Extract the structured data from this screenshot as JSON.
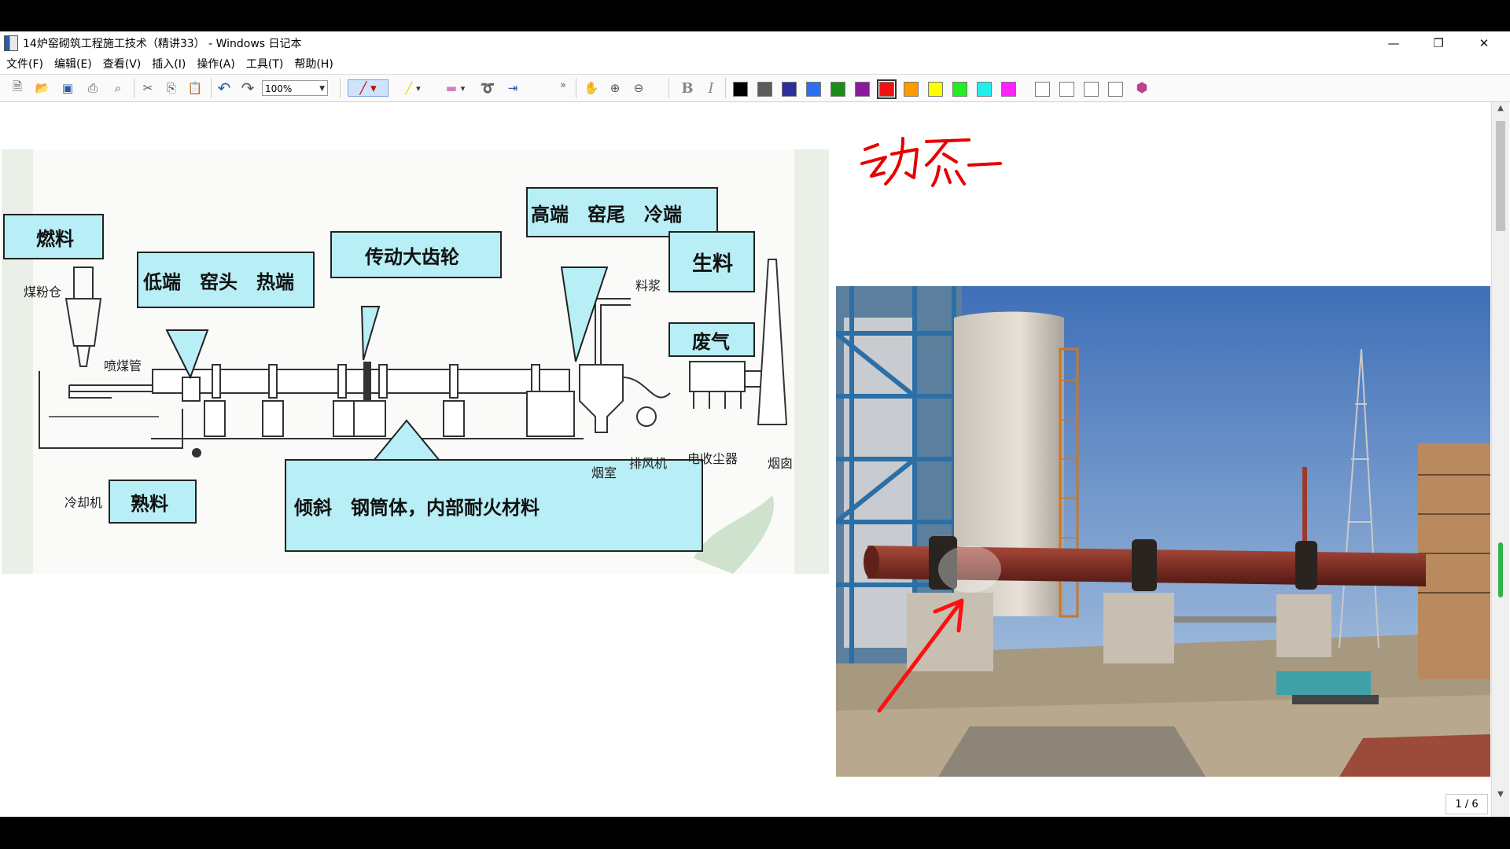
{
  "window": {
    "title": "14炉窑砌筑工程施工技术（精讲33） - Windows 日记本"
  },
  "menu": [
    "文件(F)",
    "编辑(E)",
    "查看(V)",
    "插入(I)",
    "操作(A)",
    "工具(T)",
    "帮助(H)"
  ],
  "toolbar": {
    "zoom_value": "100%",
    "colors": [
      "#000000",
      "#5c5c5c",
      "#2d2d9c",
      "#2e6ff2",
      "#1a8c1a",
      "#8c1a9c",
      "#ee1111",
      "#ff9900",
      "#ffff00",
      "#22ee22",
      "#22eeee",
      "#ff22ff",
      "#ffffff",
      "#ffffff",
      "#ffffff",
      "#ffffff"
    ],
    "selected_color": "#ee1111"
  },
  "diagram": {
    "labels": {
      "fuel": "燃料",
      "low_end": "低端　窑头　热端",
      "gear": "传动大齿轮",
      "high_end": "高端　窑尾　冷端",
      "raw_material": "生料",
      "exhaust": "废气",
      "clinker": "熟料",
      "shell": "倾斜　钢筒体，内部耐火材料"
    },
    "annotations": {
      "coal_bin": "煤粉仓",
      "coal_pipe": "喷煤管",
      "cooler": "冷却机",
      "slurry": "料浆",
      "smoke_chamber": "烟室",
      "fan": "排风机",
      "dust_collector": "电收尘器",
      "chimney": "烟囱"
    }
  },
  "handwriting": "动态",
  "page_indicator": "1 / 6"
}
